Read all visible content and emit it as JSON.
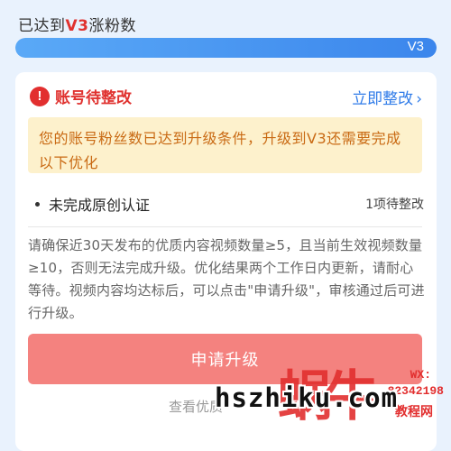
{
  "progress": {
    "title_prefix": "已达到",
    "title_highlight": "V3",
    "title_suffix": "涨粉数",
    "fill_fraction": 1.0,
    "end_label": "V3"
  },
  "card": {
    "status_icon": "exclamation-icon",
    "title": "账号待整改",
    "fix_link": "立即整改",
    "notice": "您的账号粉丝数已达到升级条件，升级到V3还需要完成以下优化",
    "item": {
      "label": "未完成原创认证",
      "status": "1项待整改"
    },
    "description": "请确保近30天发布的优质内容视频数量≥5，且当前生效视频数量≥10，否则无法完成升级。优化结果两个工作日内更新，请耐心等待。视频内容均达标后，可以点击\"申请升级\"，审核通过后可进行升级。",
    "apply_button": "申请升级",
    "more_link": "查看优质"
  },
  "watermark": {
    "logo": "蜗牛",
    "wx": "WX:",
    "number": "82342198",
    "sub": "教程网",
    "text": "hszhiku.com"
  },
  "colors": {
    "accent_red": "#e0322f",
    "link_blue": "#2f7be8",
    "notice_bg": "#fdf1cc",
    "notice_text": "#c96a14",
    "button_bg": "#f4827f"
  }
}
